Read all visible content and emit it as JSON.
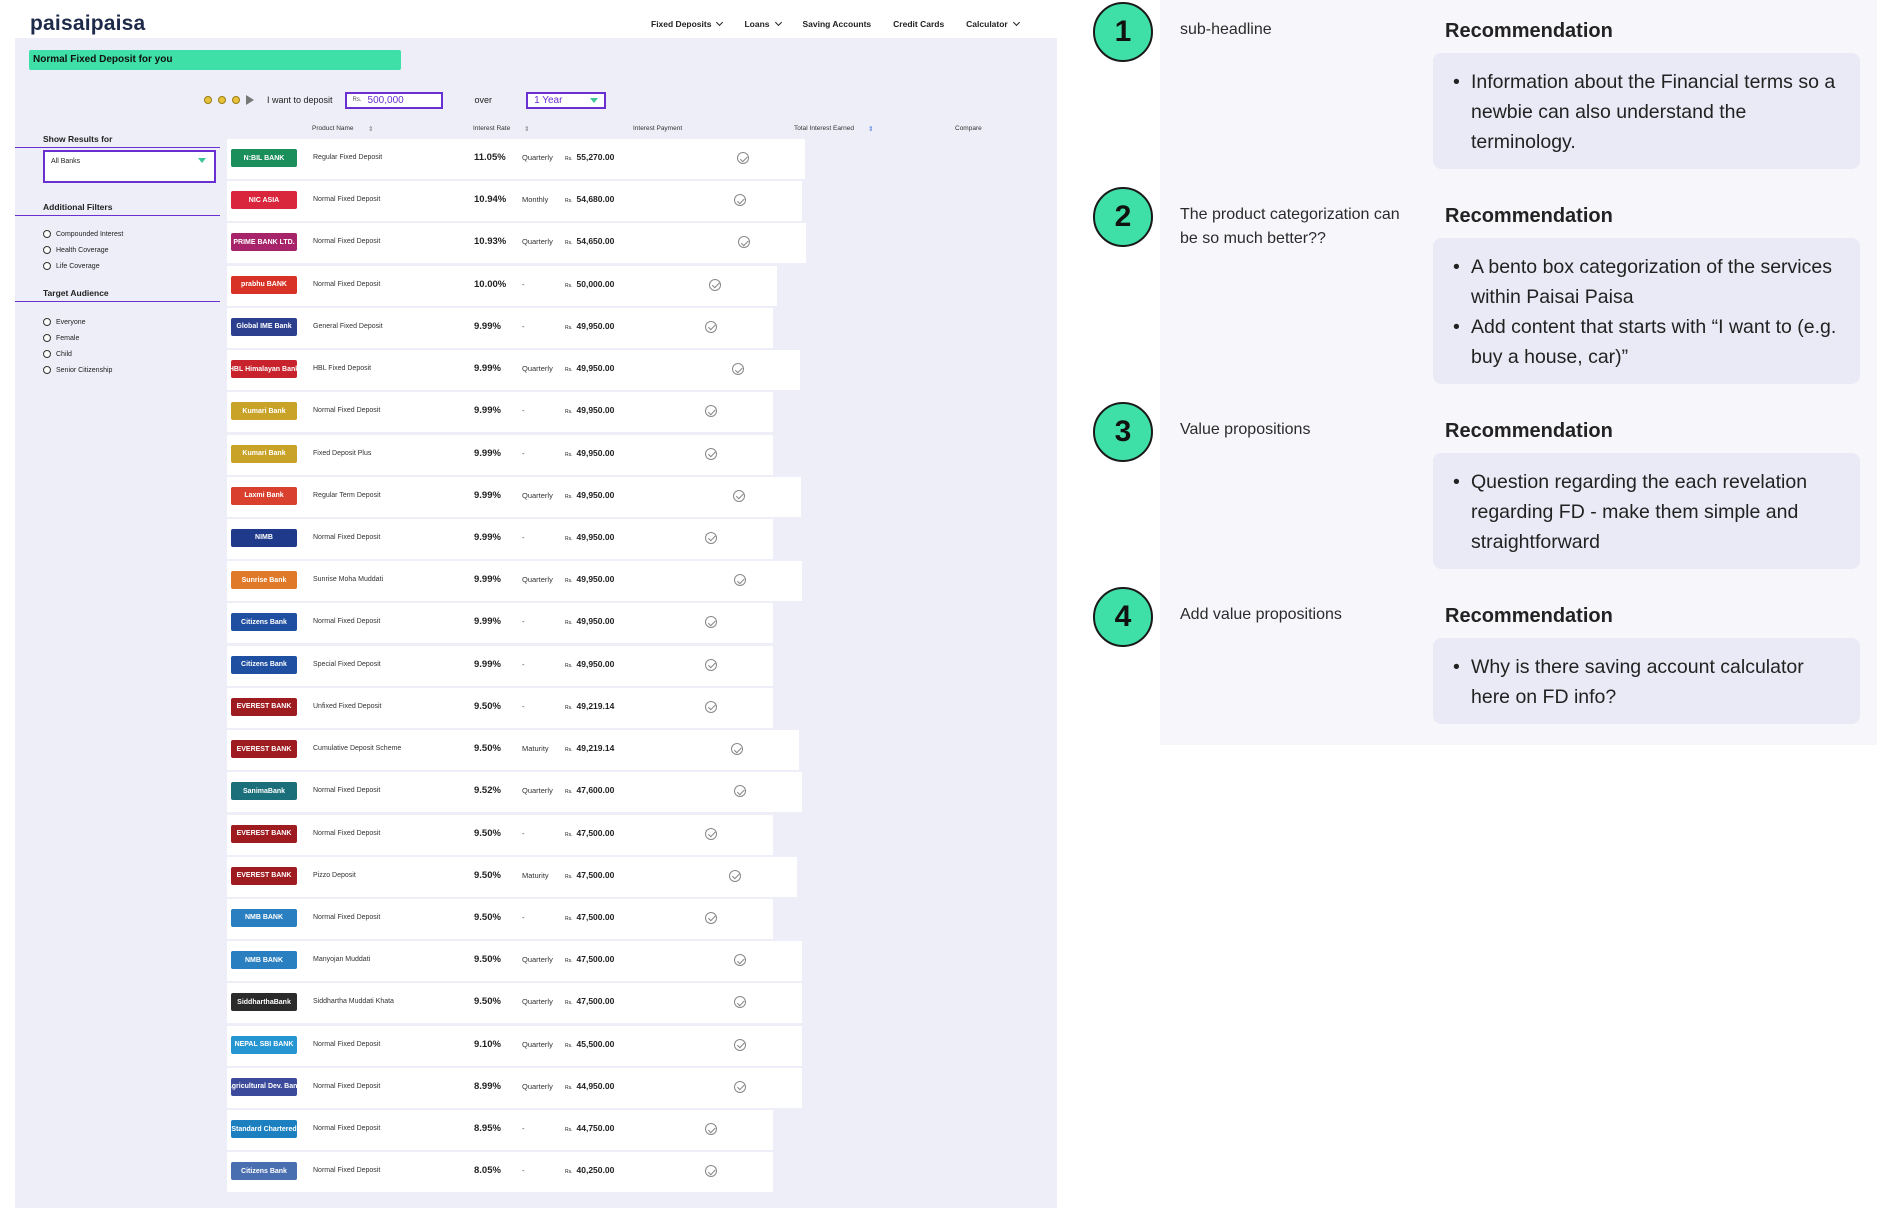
{
  "site": {
    "logo": "paisaipaisa",
    "nav": [
      {
        "label": "Fixed Deposits",
        "dropdown": true
      },
      {
        "label": "Loans",
        "dropdown": true
      },
      {
        "label": "Saving Accounts",
        "dropdown": false
      },
      {
        "label": "Credit Cards",
        "dropdown": false
      },
      {
        "label": "Calculator",
        "dropdown": true
      }
    ],
    "headline": "Normal Fixed Deposit for you",
    "deposit": {
      "prefix": "I want to deposit",
      "currency": "Rs.",
      "amount": "500,000",
      "over_label": "over",
      "period": "1 Year"
    },
    "table_headers": {
      "product": "Product Name",
      "rate": "Interest Rate",
      "payment": "Interest Payment",
      "total": "Total Interest Earned",
      "compare": "Compare"
    },
    "filters": {
      "show_results_label": "Show Results for",
      "bank_select": "All Banks",
      "additional_label": "Additional Filters",
      "additional": [
        "Compounded Interest",
        "Health Coverage",
        "Life Coverage"
      ],
      "audience_label": "Target Audience",
      "audience": [
        "Everyone",
        "Female",
        "Child",
        "Senior Citizenship"
      ]
    },
    "currency_small": "Rs.",
    "rows": [
      {
        "logo": "N:BIL BANK",
        "color": "#1a8f5c",
        "product": "Regular Fixed Deposit",
        "rate": "11.05%",
        "payment": "Quarterly",
        "total": "55,270.00"
      },
      {
        "logo": "NIC ASIA",
        "color": "#d9263d",
        "product": "Normal Fixed Deposit",
        "rate": "10.94%",
        "payment": "Monthly",
        "total": "54,680.00"
      },
      {
        "logo": "PRIME BANK LTD.",
        "color": "#a7246a",
        "product": "Normal Fixed Deposit",
        "rate": "10.93%",
        "payment": "Quarterly",
        "total": "54,650.00"
      },
      {
        "logo": "prabhu BANK",
        "color": "#d83226",
        "product": "Normal Fixed Deposit",
        "rate": "10.00%",
        "payment": "-",
        "total": "50,000.00"
      },
      {
        "logo": "Global IME Bank",
        "color": "#2c3f8f",
        "product": "General Fixed Deposit",
        "rate": "9.99%",
        "payment": "-",
        "total": "49,950.00"
      },
      {
        "logo": "HBL Himalayan Bank",
        "color": "#c8232c",
        "product": "HBL Fixed Deposit",
        "rate": "9.99%",
        "payment": "Quarterly",
        "total": "49,950.00"
      },
      {
        "logo": "Kumari Bank",
        "color": "#c9a228",
        "product": "Normal Fixed Deposit",
        "rate": "9.99%",
        "payment": "-",
        "total": "49,950.00"
      },
      {
        "logo": "Kumari Bank",
        "color": "#c9a228",
        "product": "Fixed Deposit Plus",
        "rate": "9.99%",
        "payment": "-",
        "total": "49,950.00"
      },
      {
        "logo": "Laxmi Bank",
        "color": "#d9402e",
        "product": "Regular Term Deposit",
        "rate": "9.99%",
        "payment": "Quarterly",
        "total": "49,950.00"
      },
      {
        "logo": "NIMB",
        "color": "#1f3a8a",
        "product": "Normal Fixed Deposit",
        "rate": "9.99%",
        "payment": "-",
        "total": "49,950.00"
      },
      {
        "logo": "Sunrise Bank",
        "color": "#e07a2a",
        "product": "Sunrise Moha Muddati",
        "rate": "9.99%",
        "payment": "Quarterly",
        "total": "49,950.00"
      },
      {
        "logo": "Citizens Bank",
        "color": "#1e4fa0",
        "product": "Normal Fixed Deposit",
        "rate": "9.99%",
        "payment": "-",
        "total": "49,950.00"
      },
      {
        "logo": "Citizens Bank",
        "color": "#1e4fa0",
        "product": "Special Fixed Deposit",
        "rate": "9.99%",
        "payment": "-",
        "total": "49,950.00"
      },
      {
        "logo": "EVEREST BANK",
        "color": "#9e1b20",
        "product": "Unfixed Fixed Deposit",
        "rate": "9.50%",
        "payment": "-",
        "total": "49,219.14"
      },
      {
        "logo": "EVEREST BANK",
        "color": "#9e1b20",
        "product": "Cumulative Deposit Scheme",
        "rate": "9.50%",
        "payment": "Maturity",
        "total": "49,219.14"
      },
      {
        "logo": "SanimaBank",
        "color": "#1a6f7a",
        "product": "Normal Fixed Deposit",
        "rate": "9.52%",
        "payment": "Quarterly",
        "total": "47,600.00"
      },
      {
        "logo": "EVEREST BANK",
        "color": "#9e1b20",
        "product": "Normal Fixed Deposit",
        "rate": "9.50%",
        "payment": "-",
        "total": "47,500.00"
      },
      {
        "logo": "EVEREST BANK",
        "color": "#9e1b20",
        "product": "Pizzo Deposit",
        "rate": "9.50%",
        "payment": "Maturity",
        "total": "47,500.00"
      },
      {
        "logo": "NMB BANK",
        "color": "#2a7fc1",
        "product": "Normal Fixed Deposit",
        "rate": "9.50%",
        "payment": "-",
        "total": "47,500.00"
      },
      {
        "logo": "NMB BANK",
        "color": "#2a7fc1",
        "product": "Manyojan Muddati",
        "rate": "9.50%",
        "payment": "Quarterly",
        "total": "47,500.00"
      },
      {
        "logo": "SiddharthaBank",
        "color": "#2b2b2b",
        "product": "Siddhartha Muddati Khata",
        "rate": "9.50%",
        "payment": "Quarterly",
        "total": "47,500.00"
      },
      {
        "logo": "NEPAL SBI BANK",
        "color": "#2596d1",
        "product": "Normal Fixed Deposit",
        "rate": "9.10%",
        "payment": "Quarterly",
        "total": "45,500.00"
      },
      {
        "logo": "Agricultural Dev. Bank",
        "color": "#3b4a9a",
        "product": "Normal Fixed Deposit",
        "rate": "8.99%",
        "payment": "Quarterly",
        "total": "44,950.00"
      },
      {
        "logo": "Standard Chartered",
        "color": "#1b7fc0",
        "product": "Normal Fixed Deposit",
        "rate": "8.95%",
        "payment": "-",
        "total": "44,750.00"
      },
      {
        "logo": "Citizens Bank",
        "color": "#4a6fb0",
        "product": "Normal Fixed Deposit",
        "rate": "8.05%",
        "payment": "-",
        "total": "40,250.00"
      }
    ]
  },
  "recommendations": [
    {
      "number": "1",
      "issue": "sub-headline",
      "heading": "Recommendation",
      "points": [
        "Information about the Financial terms so a newbie can also understand the terminology."
      ]
    },
    {
      "number": "2",
      "issue": "The product categorization can be so much better??",
      "heading": "Recommendation",
      "points": [
        "A bento box categorization of the services within Paisai Paisa",
        "Add content that starts with “I want to (e.g. buy a house, car)”"
      ]
    },
    {
      "number": "3",
      "issue": "Value propositions",
      "heading": "Recommendation",
      "points": [
        "Question regarding the each revelation regarding FD - make them simple and straightforward"
      ]
    },
    {
      "number": "4",
      "issue": "Add value propositions",
      "heading": "Recommendation",
      "points": [
        "Why is there saving account calculator here on FD info?"
      ]
    }
  ]
}
